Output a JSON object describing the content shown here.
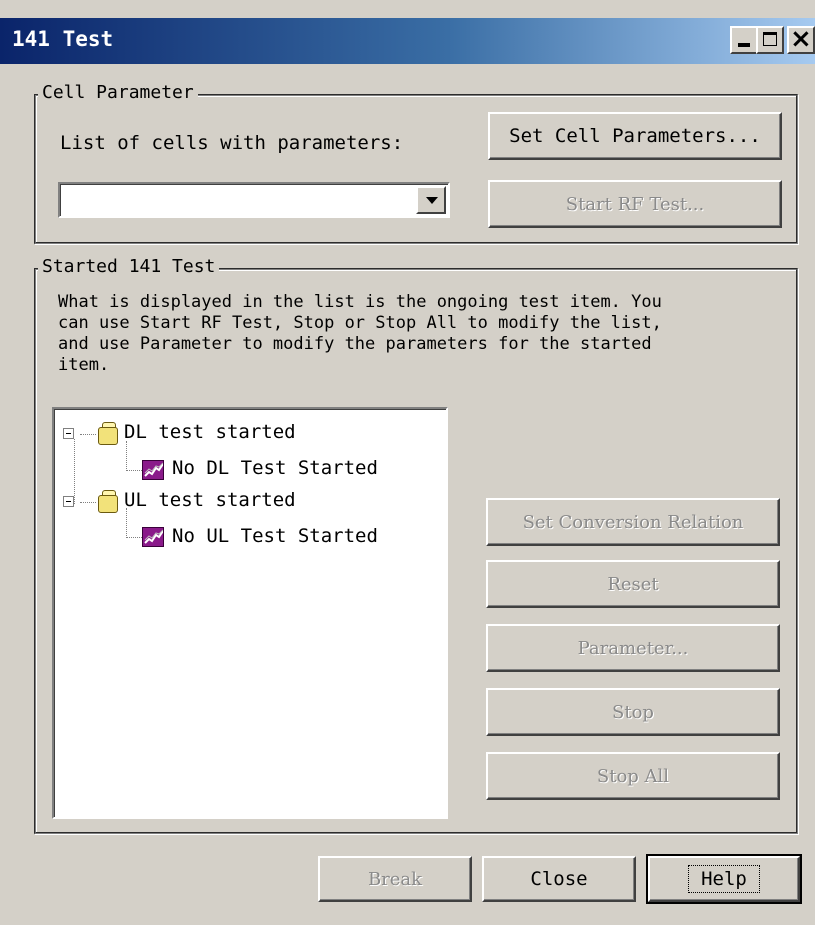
{
  "window": {
    "title": "141 Test"
  },
  "cell_parameter": {
    "group_label": "Cell Parameter",
    "list_label": "List of cells with parameters:",
    "combo_value": "",
    "set_cell_parameters_button": "Set Cell Parameters...",
    "start_rf_test_button": "Start RF Test..."
  },
  "started_test": {
    "group_label": "Started 141 Test",
    "description": "What is displayed in the list is the ongoing test item. You\ncan use Start RF Test, Stop or Stop All to modify the list,\nand use Parameter to modify the parameters for the started\nitem.",
    "tree": [
      {
        "label": "DL test started",
        "icon": "folder-icon",
        "child": {
          "label": "No DL Test Started",
          "icon": "test-icon"
        }
      },
      {
        "label": "UL test started",
        "icon": "folder-icon",
        "child": {
          "label": "No UL Test Started",
          "icon": "test-icon"
        }
      }
    ],
    "buttons": {
      "set_conversion_relation": "Set Conversion Relation",
      "reset": "Reset",
      "parameter": "Parameter...",
      "stop": "Stop",
      "stop_all": "Stop All"
    }
  },
  "footer": {
    "break": "Break",
    "close": "Close",
    "help": "Help"
  },
  "colors": {
    "titlebar_start": "#0a246a",
    "titlebar_end": "#a6caf0",
    "dialog_bg": "#d4d0c8",
    "disabled_text": "#8a8a8a"
  }
}
